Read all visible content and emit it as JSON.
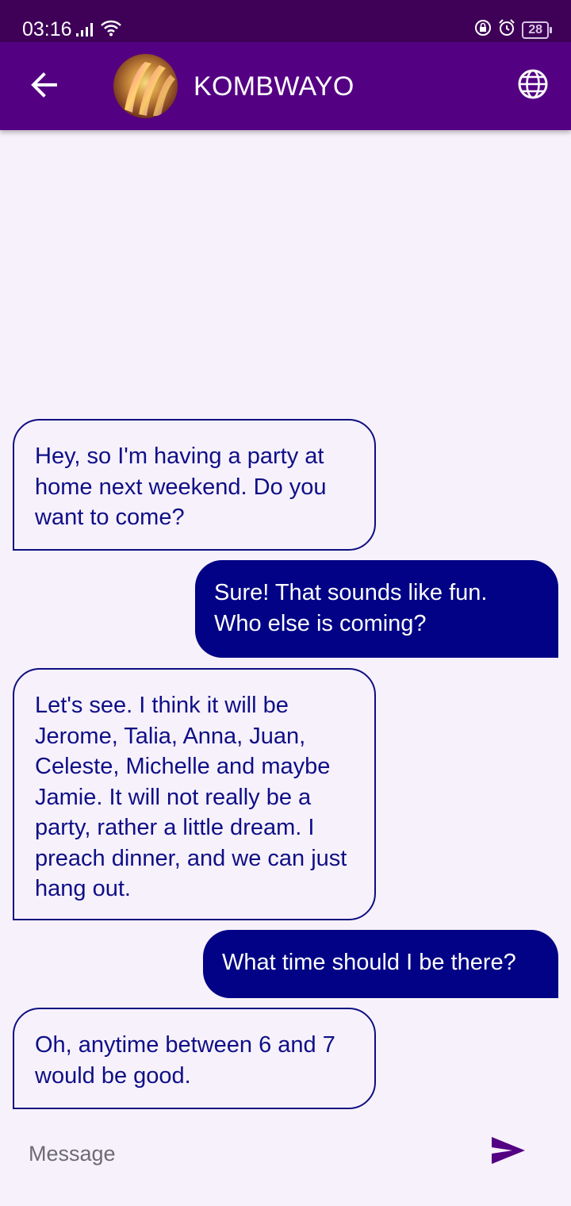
{
  "status_bar": {
    "time": "03:16",
    "battery": "28"
  },
  "header": {
    "title": "KOMBWAYO"
  },
  "messages": [
    {
      "from": "them",
      "text": "Hey, so I'm having a party at home next weekend. Do you want to come?"
    },
    {
      "from": "me",
      "text": "Sure! That sounds like fun. Who else is coming?"
    },
    {
      "from": "them",
      "text": "Let's see. I think it will be Jerome, Talia, Anna, Juan, Celeste, Michelle and maybe Jamie. It will not really be a party, rather a little dream. I preach dinner, and we can just hang out."
    },
    {
      "from": "me",
      "text": "What time should I be there?"
    },
    {
      "from": "them",
      "text": "Oh, anytime between 6 and 7 would be good."
    }
  ],
  "composer": {
    "placeholder": "Message"
  },
  "colors": {
    "app_bar": "#540083",
    "status_bar": "#3e0157",
    "incoming_text": "#0f0f87",
    "outgoing_bubble": "#010285",
    "send_icon": "#540083"
  }
}
